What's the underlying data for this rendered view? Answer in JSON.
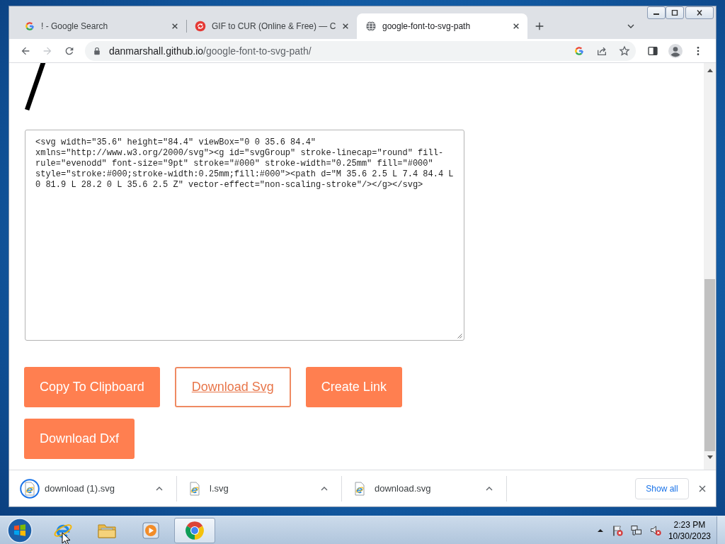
{
  "browser": {
    "tabs": [
      {
        "title": "! - Google Search",
        "selected": false
      },
      {
        "title": "GIF to CUR (Online & Free) — C",
        "selected": false
      },
      {
        "title": "google-font-to-svg-path",
        "selected": true
      }
    ],
    "back": {
      "disabled": false
    },
    "forward": {
      "disabled": true
    },
    "address": {
      "host": "danmarshall.github.io",
      "path": "/google-font-to-svg-path/"
    }
  },
  "page": {
    "svg_output": "<svg width=\"35.6\" height=\"84.4\" viewBox=\"0 0 35.6 84.4\" xmlns=\"http://www.w3.org/2000/svg\"><g id=\"svgGroup\" stroke-linecap=\"round\" fill-rule=\"evenodd\" font-size=\"9pt\" stroke=\"#000\" stroke-width=\"0.25mm\" fill=\"#000\" style=\"stroke:#000;stroke-width:0.25mm;fill:#000\"><path d=\"M 35.6 2.5 L 7.4 84.4 L 0 81.9 L 28.2 0 L 35.6 2.5 Z\" vector-effect=\"non-scaling-stroke\"/></g></svg>",
    "buttons": [
      {
        "label": "Copy To Clipboard",
        "kind": "filled"
      },
      {
        "label": "Download Svg",
        "kind": "link"
      },
      {
        "label": "Create Link",
        "kind": "filled"
      },
      {
        "label": "Download Dxf",
        "kind": "filled"
      }
    ]
  },
  "downloads": {
    "items": [
      {
        "name": "download (1).svg",
        "progress_ring": true
      },
      {
        "name": "l.svg",
        "progress_ring": false
      },
      {
        "name": "download.svg",
        "progress_ring": false
      }
    ],
    "show_all": "Show all"
  },
  "taskbar": {
    "apps": [
      {
        "selected": false
      },
      {
        "selected": false
      },
      {
        "selected": false
      },
      {
        "selected": true
      }
    ],
    "time": "2:23 PM",
    "date": "10/30/2023"
  }
}
